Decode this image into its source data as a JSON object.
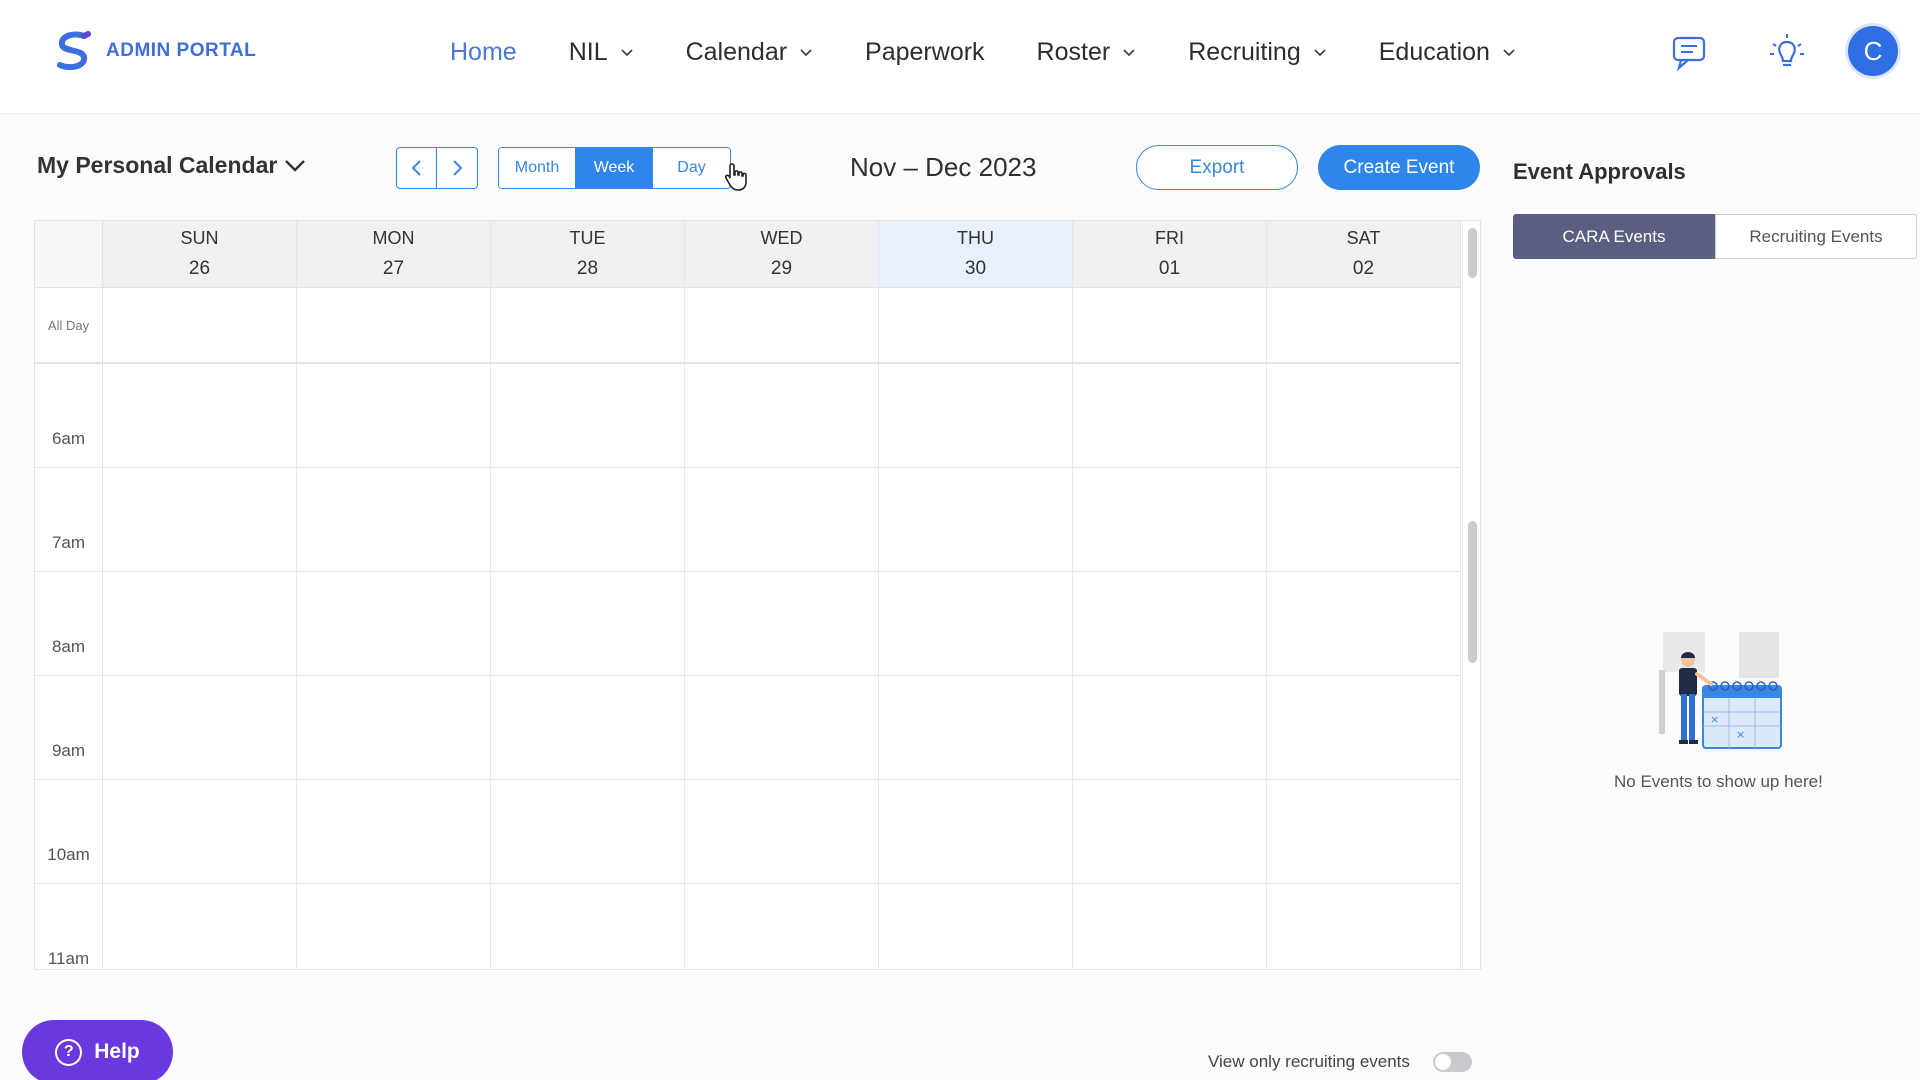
{
  "app": {
    "title": "ADMIN PORTAL",
    "colors": {
      "primary": "#2f86ea",
      "nav_active": "#4a78d9",
      "help": "#6a38dd",
      "tab_active": "#5a5e80"
    }
  },
  "nav": {
    "items": [
      {
        "label": "Home",
        "dropdown": false,
        "active": true
      },
      {
        "label": "NIL",
        "dropdown": true
      },
      {
        "label": "Calendar",
        "dropdown": true
      },
      {
        "label": "Paperwork",
        "dropdown": false
      },
      {
        "label": "Roster",
        "dropdown": true
      },
      {
        "label": "Recruiting",
        "dropdown": true
      },
      {
        "label": "Education",
        "dropdown": true
      }
    ],
    "icons": [
      "chat-icon",
      "lightbulb-icon"
    ],
    "avatar_initial": "C"
  },
  "toolbar": {
    "calendar_name": "My Personal Calendar",
    "views": [
      "Month",
      "Week",
      "Day"
    ],
    "active_view": "Week",
    "range": "Nov – Dec 2023",
    "export_label": "Export",
    "create_label": "Create Event"
  },
  "calendar": {
    "days": [
      {
        "name": "SUN",
        "num": "26"
      },
      {
        "name": "MON",
        "num": "27"
      },
      {
        "name": "TUE",
        "num": "28"
      },
      {
        "name": "WED",
        "num": "29"
      },
      {
        "name": "THU",
        "num": "30",
        "today": true
      },
      {
        "name": "FRI",
        "num": "01"
      },
      {
        "name": "SAT",
        "num": "02"
      }
    ],
    "all_day_label": "All Day",
    "times": [
      "6am",
      "7am",
      "8am",
      "9am",
      "10am",
      "11am"
    ]
  },
  "approvals": {
    "title": "Event Approvals",
    "tabs": [
      "CARA Events",
      "Recruiting Events"
    ],
    "active_tab": "CARA Events",
    "empty_text": "No Events to show up here!"
  },
  "footer": {
    "help_label": "Help",
    "toggle_label": "View only recruiting events"
  }
}
